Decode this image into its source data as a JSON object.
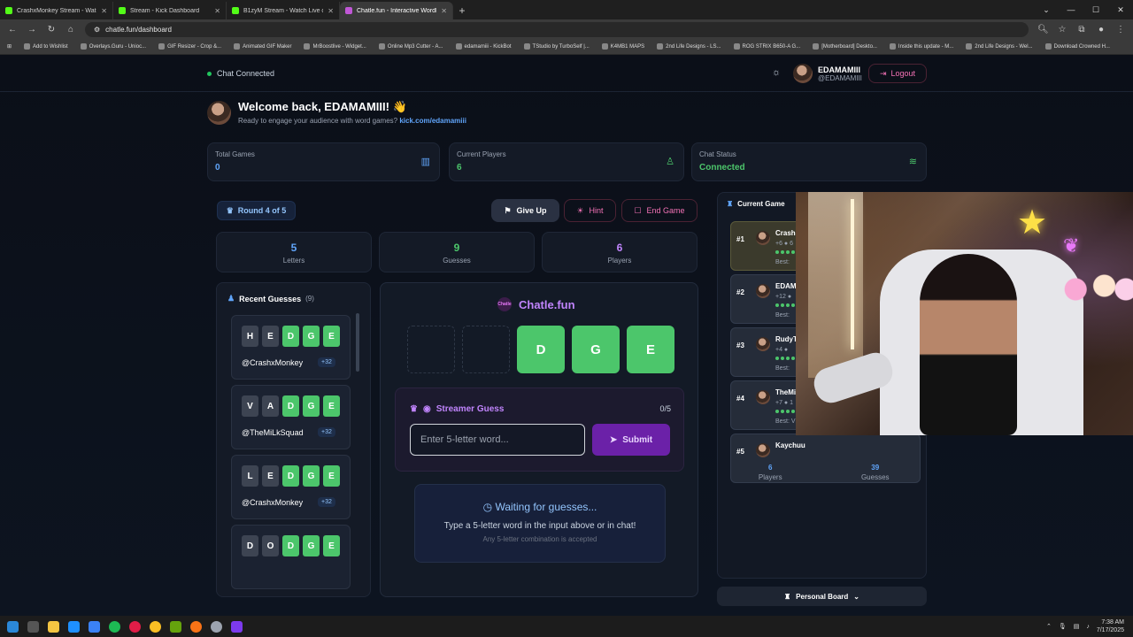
{
  "browser": {
    "tabs": [
      {
        "title": "CrashxMonkey Stream - Watch Li...",
        "favicon": "kick-icon"
      },
      {
        "title": "Stream - Kick Dashboard",
        "favicon": "kick-icon"
      },
      {
        "title": "B1zyM Stream - Watch Live on Ki...",
        "favicon": "kick-icon"
      },
      {
        "title": "Chatle.fun - Interactive Wordle Ga...",
        "favicon": "chatle-icon",
        "active": true
      }
    ],
    "url": "chatle.fun/dashboard",
    "bookmarks": [
      "Add to Wishlist",
      "Overlays.Guru - Unioc...",
      "GIF Resizer - Crop &...",
      "Animated GIF Maker",
      "MrBoostlive - Widget...",
      "Online Mp3 Cutter - A...",
      "edamamiii - KickBot",
      "TStudio by TurboSelf |...",
      "K4MB1 MAPS",
      "2nd Life Designs - LS...",
      "ROG STRIX B650-A G...",
      "[Motherboard] Deskto...",
      "Inside this update - M...",
      "2nd Life Designs - Wel...",
      "Download Crowned H..."
    ]
  },
  "header": {
    "chat_status": "Chat Connected",
    "user_name": "EDAMAMIII",
    "user_handle": "@EDAMAMIII",
    "logout_label": "Logout"
  },
  "welcome": {
    "title": "Welcome back, EDAMAMIII! 👋",
    "subtitle": "Ready to engage your audience with word games?",
    "link": "kick.com/edamamiii"
  },
  "stats": [
    {
      "label": "Total Games",
      "value": "0"
    },
    {
      "label": "Current Players",
      "value": "6"
    },
    {
      "label": "Chat Status",
      "value": "Connected"
    }
  ],
  "game": {
    "round_label": "Round 4 of 5",
    "give_up_label": "Give Up",
    "hint_label": "Hint",
    "end_game_label": "End Game",
    "mini_stats": [
      {
        "value": "5",
        "label": "Letters"
      },
      {
        "value": "9",
        "label": "Guesses"
      },
      {
        "value": "6",
        "label": "Players"
      }
    ]
  },
  "recent": {
    "title": "Recent Guesses",
    "count": "(9)",
    "guesses": [
      {
        "letters": [
          "H",
          "E",
          "D",
          "G",
          "E"
        ],
        "correct": [
          false,
          false,
          true,
          true,
          true
        ],
        "user": "@CrashxMonkey",
        "points": "+32"
      },
      {
        "letters": [
          "V",
          "A",
          "D",
          "G",
          "E"
        ],
        "correct": [
          false,
          false,
          true,
          true,
          true
        ],
        "user": "@TheMiLkSquad",
        "points": "+32"
      },
      {
        "letters": [
          "L",
          "E",
          "D",
          "G",
          "E"
        ],
        "correct": [
          false,
          false,
          true,
          true,
          true
        ],
        "user": "@CrashxMonkey",
        "points": "+32"
      },
      {
        "letters": [
          "D",
          "O",
          "D",
          "G",
          "E"
        ],
        "correct": [
          false,
          false,
          true,
          true,
          true
        ],
        "user": "",
        "points": ""
      }
    ]
  },
  "board": {
    "logo_text": "Chatle.fun",
    "logo_badge": "Chatle",
    "tiles": [
      "",
      "",
      "D",
      "G",
      "E"
    ],
    "streamer_guess_label": "Streamer Guess",
    "guess_count": "0/5",
    "input_placeholder": "Enter 5-letter word...",
    "submit_label": "Submit",
    "waiting_title": "Waiting for guesses...",
    "waiting_text": "Type a 5-letter word in the input above or in chat!",
    "waiting_note": "Any 5-letter combination is accepted"
  },
  "current_game": {
    "title": "Current Game",
    "players": [
      {
        "rank": "#1",
        "name": "Crash",
        "points": "+6 ● 6",
        "best": "Best:"
      },
      {
        "rank": "#2",
        "name": "EDAM",
        "points": "+12 ●",
        "best": "Best:"
      },
      {
        "rank": "#3",
        "name": "RudyT",
        "points": "+4 ●",
        "best": "Best:"
      },
      {
        "rank": "#4",
        "name": "TheMi",
        "points": "+7 ● 1",
        "best": "Best: V"
      },
      {
        "rank": "#5",
        "name": "Kaychuu",
        "points": "",
        "best": ""
      }
    ],
    "footer": [
      {
        "value": "6",
        "label": "Players"
      },
      {
        "value": "39",
        "label": "Guesses"
      }
    ],
    "personal_board_label": "Personal Board"
  },
  "taskbar": {
    "time": "7:38 AM",
    "date": "7/17/2025"
  },
  "colors": {
    "accent_green": "#4cc66b",
    "accent_purple": "#c084fc",
    "accent_blue": "#60a5fa",
    "accent_pink": "#f472b6"
  }
}
